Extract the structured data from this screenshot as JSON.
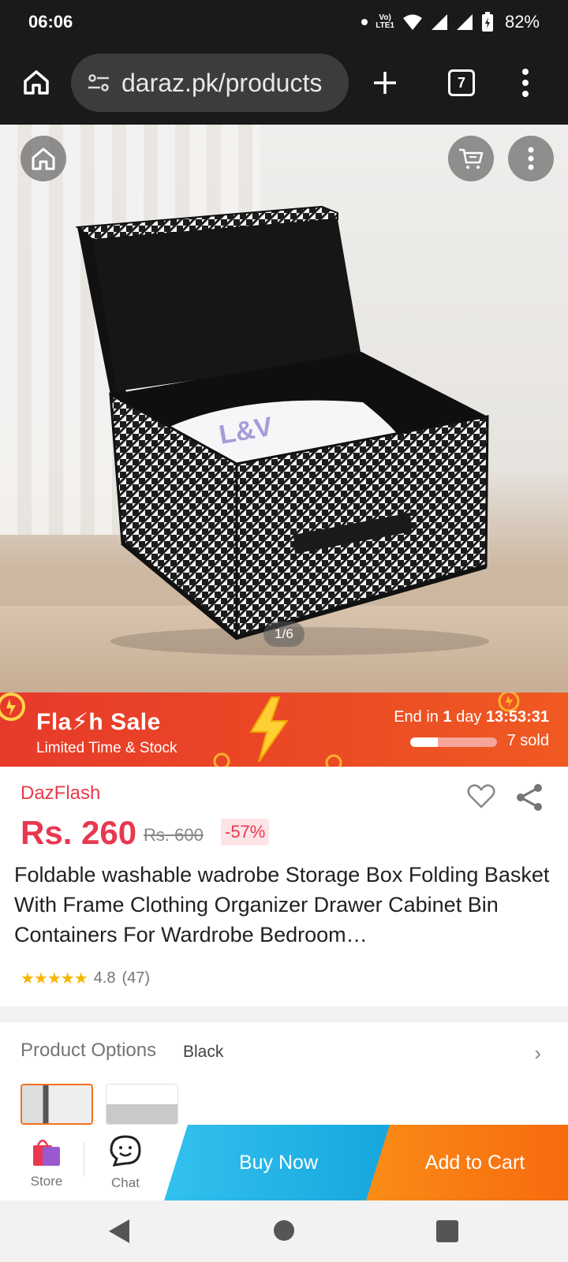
{
  "status_bar": {
    "time": "06:06",
    "network": "LTE1",
    "battery": "82%"
  },
  "browser": {
    "url": "daraz.pk/products",
    "tab_count": "7"
  },
  "hero": {
    "image_counter": "1/6"
  },
  "flash_sale": {
    "title": "Fla⚡h Sale",
    "subtitle": "Limited Time & Stock",
    "end_prefix": "End in ",
    "end_days": "1",
    "end_mid": " day ",
    "end_time": "13:53:31",
    "sold": "7 sold",
    "progress_fraction": 0.32
  },
  "product": {
    "store": "DazFlash",
    "price": "Rs. 260",
    "original_price": "Rs. 600",
    "discount": "-57%",
    "title": "Foldable washable wadrobe Storage Box Folding Basket With Frame Clothing Organizer Drawer Cabinet Bin Containers For Wardrobe Bedroom…",
    "rating": "4.8",
    "review_count": "(47)"
  },
  "options": {
    "label": "Product Options",
    "selected": "Black"
  },
  "action_bar": {
    "store_label": "Store",
    "chat_label": "Chat",
    "buy_now": "Buy Now",
    "add_to_cart": "Add to Cart"
  },
  "colors": {
    "accent_red": "#e8384f",
    "flash_orange": "#ea4a25",
    "buy_blue": "#15a6dc",
    "cart_orange": "#f76a0f"
  }
}
